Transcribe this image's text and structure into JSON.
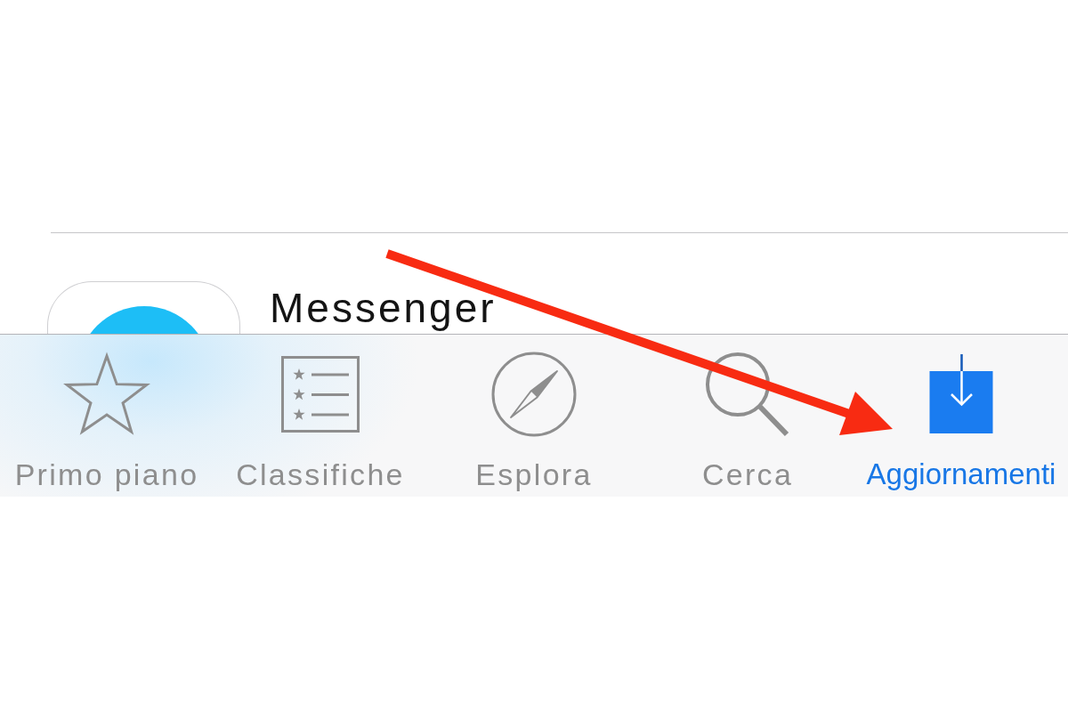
{
  "list": {
    "items": [
      {
        "name": "Messenger"
      }
    ]
  },
  "tab_bar": {
    "tabs": [
      {
        "label": "Primo piano",
        "selected": false
      },
      {
        "label": "Classifiche",
        "selected": false
      },
      {
        "label": "Esplora",
        "selected": false
      },
      {
        "label": "Cerca",
        "selected": false
      },
      {
        "label": "Aggiornamenti",
        "selected": true
      }
    ]
  },
  "annotations": [
    {
      "kind": "arrow"
    }
  ]
}
